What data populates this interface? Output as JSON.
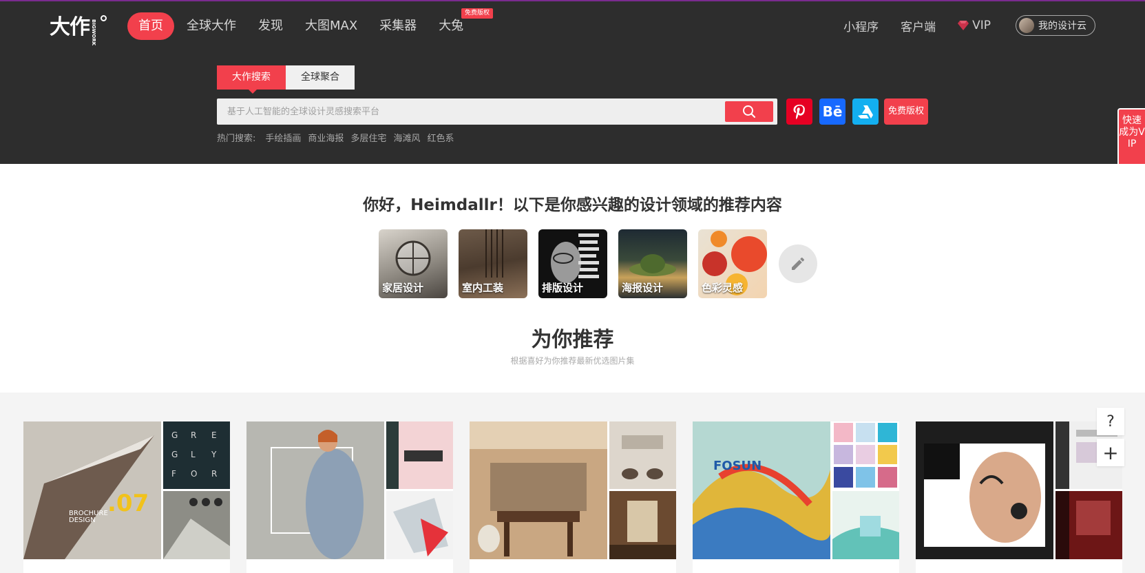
{
  "logo": {
    "text": "大作",
    "sub": "BIGWORK"
  },
  "nav": {
    "items": [
      "首页",
      "全球大作",
      "发现",
      "大图MAX",
      "采集器",
      "大兔"
    ],
    "badge": "免费版权",
    "right": {
      "mini": "小程序",
      "client": "客户端",
      "vip": "VIP",
      "cloud": "我的设计云"
    }
  },
  "search": {
    "tabs": [
      "大作搜索",
      "全球聚合"
    ],
    "placeholder": "基于人工智能的全球设计灵感搜索平台",
    "free_label": "免费版权",
    "hot_label": "热门搜索:",
    "hot_items": [
      "手绘插画",
      "商业海报",
      "多层住宅",
      "海滩风",
      "红色系"
    ]
  },
  "vip_float": "快速成为VIP",
  "greeting": "你好，Heimdallr！以下是你感兴趣的设计领域的推荐内容",
  "categories": [
    "家居设计",
    "室内工装",
    "排版设计",
    "海报设计",
    "色彩灵感"
  ],
  "recommend": {
    "title": "为你推荐",
    "subtitle": "根据喜好为你推荐最新优选图片集"
  },
  "floating": {
    "help": "?",
    "add": "+"
  },
  "colors": {
    "accent": "#f2404c",
    "header_bg": "#2d2d2d",
    "pinterest": "#e60023",
    "behance": "#1769ff",
    "artstation": "#13aff0"
  },
  "icons": [
    "search-icon",
    "pinterest-icon",
    "behance-icon",
    "artstation-icon",
    "pencil-icon",
    "vip-gem-icon"
  ]
}
